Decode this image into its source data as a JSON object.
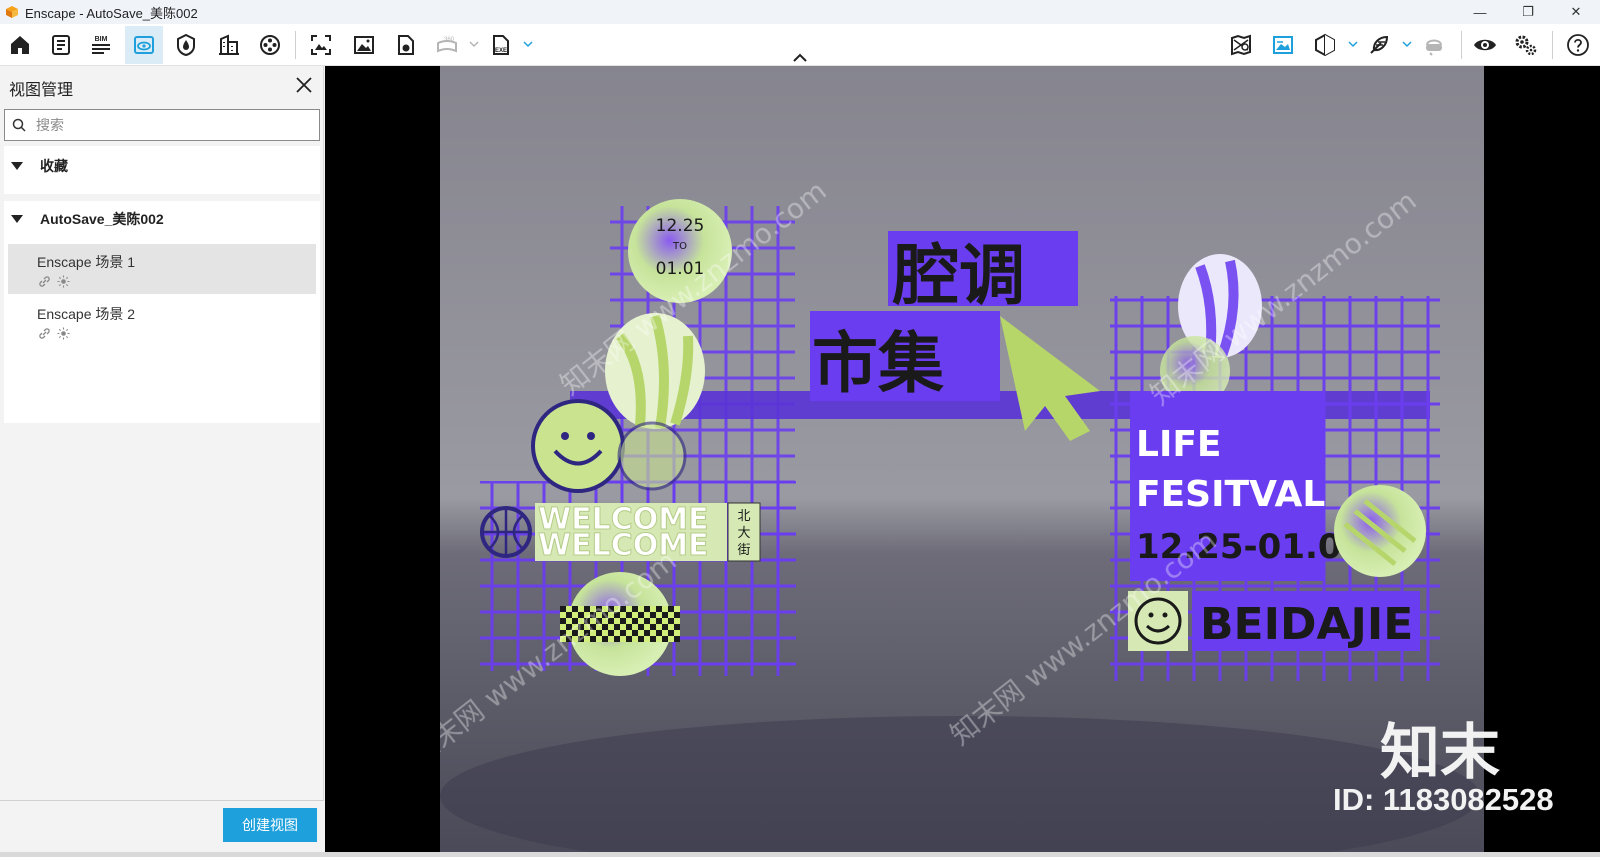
{
  "window": {
    "title": "Enscape - AutoSave_美陈002",
    "minimize": "—",
    "restore": "❐",
    "close": "✕"
  },
  "toolbar": {
    "bim_label": "BIM",
    "view360_label": "360",
    "exe_label": "EXE",
    "active_tool": "view-management",
    "accent": "#1ea0dc"
  },
  "panel": {
    "title": "视图管理",
    "search_placeholder": "搜索",
    "favorites_label": "收藏",
    "project_label": "AutoSave_美陈002",
    "views": [
      {
        "name": "Enscape 场景 1",
        "selected": true
      },
      {
        "name": "Enscape 场景 2",
        "selected": false
      }
    ],
    "create_view_label": "创建视图"
  },
  "scene": {
    "badge_date_1": "12.25",
    "badge_to": "TO",
    "badge_date_2": "01.01",
    "sign_line_1": "腔调",
    "sign_line_2": "市集",
    "life": "LIFE",
    "festival": "FESITVAL",
    "date_range": "12.25-01.01",
    "beidajie": "BEIDAJIE",
    "welcome": "WELCOME",
    "street_1": "北",
    "street_2": "大",
    "street_3": "街"
  },
  "watermark": {
    "site": "知末网 www.znzmo.com",
    "logo": "知末",
    "id": "ID: 1183082528"
  }
}
